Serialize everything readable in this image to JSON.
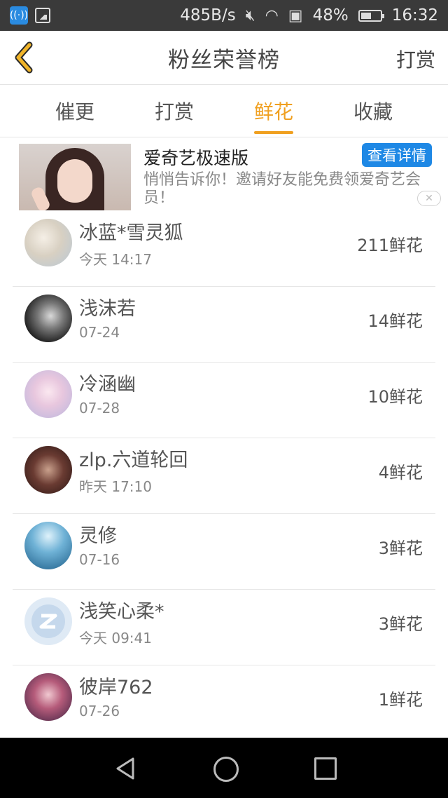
{
  "status_bar": {
    "net_speed": "485B/s",
    "battery": "48%",
    "time": "16:32"
  },
  "header": {
    "title": "粉丝荣誉榜",
    "action": "打赏"
  },
  "tabs": [
    {
      "label": "催更",
      "active": false
    },
    {
      "label": "打赏",
      "active": false
    },
    {
      "label": "鲜花",
      "active": true
    },
    {
      "label": "收藏",
      "active": false
    }
  ],
  "ad": {
    "title": "爱奇艺极速版",
    "button": "查看详情",
    "description": "悄悄告诉你！邀请好友能免费领爱奇艺会员！"
  },
  "fans": [
    {
      "name": "冰蓝*雪灵狐",
      "time": "今天 14:17",
      "count": "211鲜花"
    },
    {
      "name": "浅沫若",
      "time": "07-24",
      "count": "14鲜花"
    },
    {
      "name": "冷涵幽",
      "time": "07-28",
      "count": "10鲜花"
    },
    {
      "name": "zlp.六道轮回",
      "time": "昨天 17:10",
      "count": "4鲜花"
    },
    {
      "name": "灵修",
      "time": "07-16",
      "count": "3鲜花"
    },
    {
      "name": "浅笑心柔*",
      "time": "今天 09:41",
      "count": "3鲜花"
    },
    {
      "name": "彼岸762",
      "time": "07-26",
      "count": "1鲜花"
    }
  ],
  "colors": {
    "accent": "#f0a020",
    "ad_button": "#1e88e5"
  }
}
